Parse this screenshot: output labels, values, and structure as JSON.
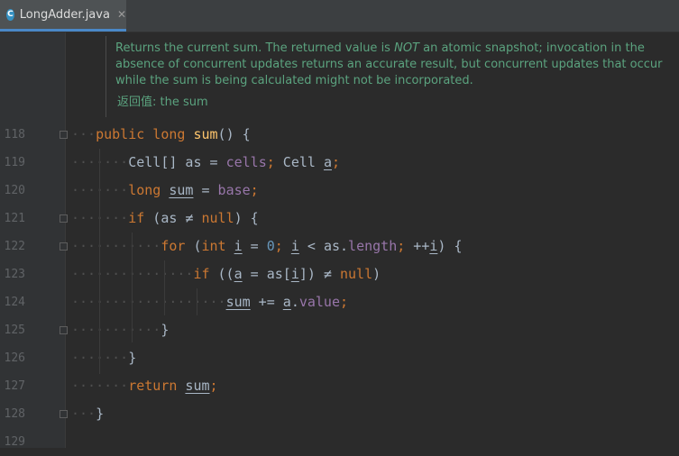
{
  "tab": {
    "icon_letter": "C",
    "filename": "LongAdder.java",
    "close": "✕"
  },
  "doc": {
    "part1": "Returns the current sum. The returned value is ",
    "emph": "NOT",
    "part2": " an atomic snapshot; invocation in the absence of concurrent updates returns an accurate result, but concurrent updates that occur while the sum is being calculated might not be incorporated.",
    "return_label": "返回值:",
    "return_value": "the sum"
  },
  "lines": [
    {
      "num": "118",
      "dots": "···",
      "tokens": [
        [
          "kw",
          "public "
        ],
        [
          "kw",
          "long "
        ],
        [
          "fn",
          "sum"
        ],
        [
          "",
          "() {"
        ]
      ]
    },
    {
      "num": "119",
      "dots": "·······",
      "tokens": [
        [
          "",
          "Cell[] as = "
        ],
        [
          "fld",
          "cells"
        ],
        [
          "kw",
          "; "
        ],
        [
          "",
          "Cell "
        ],
        [
          "u",
          "a"
        ],
        [
          "kw",
          ";"
        ]
      ]
    },
    {
      "num": "120",
      "dots": "·······",
      "tokens": [
        [
          "kw",
          "long "
        ],
        [
          "u",
          "sum"
        ],
        [
          "",
          " = "
        ],
        [
          "fld",
          "base"
        ],
        [
          "kw",
          ";"
        ]
      ]
    },
    {
      "num": "121",
      "dots": "·······",
      "tokens": [
        [
          "kw",
          "if "
        ],
        [
          "",
          "(as ≠ "
        ],
        [
          "kw",
          "null"
        ],
        [
          "",
          ") {"
        ]
      ]
    },
    {
      "num": "122",
      "dots": "···········",
      "tokens": [
        [
          "kw",
          "for "
        ],
        [
          "",
          "("
        ],
        [
          "kw",
          "int "
        ],
        [
          "u",
          "i"
        ],
        [
          "",
          " = "
        ],
        [
          "num",
          "0"
        ],
        [
          "kw",
          "; "
        ],
        [
          "u",
          "i"
        ],
        [
          "",
          " < as."
        ],
        [
          "fld",
          "length"
        ],
        [
          "kw",
          "; "
        ],
        [
          "",
          "++"
        ],
        [
          "u",
          "i"
        ],
        [
          "",
          ") {"
        ]
      ]
    },
    {
      "num": "123",
      "dots": "···············",
      "tokens": [
        [
          "kw",
          "if "
        ],
        [
          "",
          "(("
        ],
        [
          "u",
          "a"
        ],
        [
          "",
          " = as["
        ],
        [
          "u",
          "i"
        ],
        [
          "",
          "]) ≠ "
        ],
        [
          "kw",
          "null"
        ],
        [
          "",
          ")"
        ]
      ]
    },
    {
      "num": "124",
      "dots": "···················",
      "tokens": [
        [
          "u",
          "sum"
        ],
        [
          "",
          " += "
        ],
        [
          "u",
          "a"
        ],
        [
          "",
          "."
        ],
        [
          "fld",
          "value"
        ],
        [
          "kw",
          ";"
        ]
      ]
    },
    {
      "num": "125",
      "dots": "···········",
      "tokens": [
        [
          "",
          "}"
        ]
      ]
    },
    {
      "num": "126",
      "dots": "·······",
      "tokens": [
        [
          "",
          "}"
        ]
      ]
    },
    {
      "num": "127",
      "dots": "·······",
      "tokens": [
        [
          "kw",
          "return "
        ],
        [
          "u",
          "sum"
        ],
        [
          "kw",
          ";"
        ]
      ]
    },
    {
      "num": "128",
      "dots": "···",
      "tokens": [
        [
          "",
          "}"
        ]
      ]
    },
    {
      "num": "129",
      "dots": "",
      "tokens": []
    }
  ]
}
